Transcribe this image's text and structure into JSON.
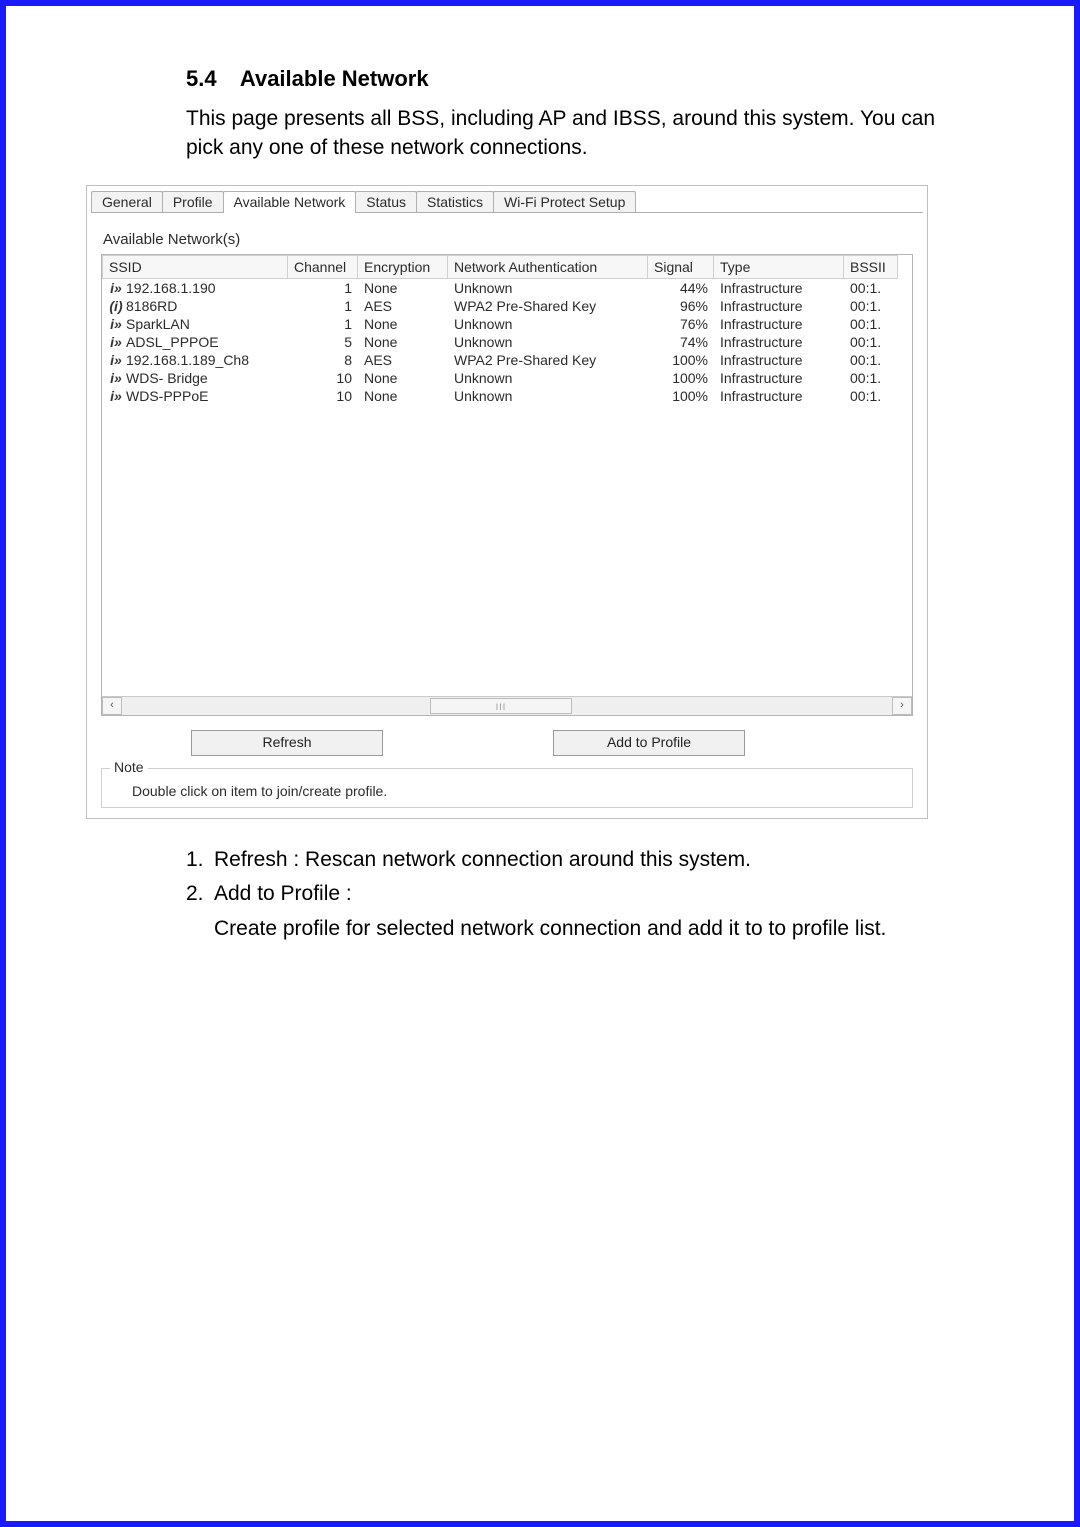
{
  "section": {
    "number": "5.4",
    "title": "Available Network",
    "intro": "This page presents all BSS, including AP and IBSS, around this system. You can pick any one of these network connections."
  },
  "tabs": {
    "general": "General",
    "profile": "Profile",
    "available_network": "Available Network",
    "status": "Status",
    "statistics": "Statistics",
    "wps": "Wi-Fi Protect Setup"
  },
  "group_label": "Available Network(s)",
  "columns": {
    "ssid": "SSID",
    "channel": "Channel",
    "encryption": "Encryption",
    "auth": "Network Authentication",
    "signal": "Signal",
    "type": "Type",
    "bssid": "BSSII"
  },
  "networks": [
    {
      "icon": "i»",
      "ssid": "192.168.1.190",
      "channel": "1",
      "encryption": "None",
      "auth": "Unknown",
      "signal": "44%",
      "type": "Infrastructure",
      "bssid": "00:1."
    },
    {
      "icon": "(i)",
      "ssid": "8186RD",
      "channel": "1",
      "encryption": "AES",
      "auth": "WPA2 Pre-Shared Key",
      "signal": "96%",
      "type": "Infrastructure",
      "bssid": "00:1."
    },
    {
      "icon": "i»",
      "ssid": "SparkLAN",
      "channel": "1",
      "encryption": "None",
      "auth": "Unknown",
      "signal": "76%",
      "type": "Infrastructure",
      "bssid": "00:1."
    },
    {
      "icon": "i»",
      "ssid": "ADSL_PPPOE",
      "channel": "5",
      "encryption": "None",
      "auth": "Unknown",
      "signal": "74%",
      "type": "Infrastructure",
      "bssid": "00:1."
    },
    {
      "icon": "i»",
      "ssid": "192.168.1.189_Ch8",
      "channel": "8",
      "encryption": "AES",
      "auth": "WPA2 Pre-Shared Key",
      "signal": "100%",
      "type": "Infrastructure",
      "bssid": "00:1."
    },
    {
      "icon": "i»",
      "ssid": "WDS- Bridge",
      "channel": "10",
      "encryption": "None",
      "auth": "Unknown",
      "signal": "100%",
      "type": "Infrastructure",
      "bssid": "00:1."
    },
    {
      "icon": "i»",
      "ssid": "WDS-PPPoE",
      "channel": "10",
      "encryption": "None",
      "auth": "Unknown",
      "signal": "100%",
      "type": "Infrastructure",
      "bssid": "00:1."
    }
  ],
  "buttons": {
    "refresh": "Refresh",
    "add_to_profile": "Add to Profile"
  },
  "note": {
    "legend": "Note",
    "text": "Double click on item to join/create profile."
  },
  "after_list": {
    "item1_label": "Refresh : Rescan network connection around this system.",
    "item2_label": "Add to Profile :",
    "item2_desc": "Create profile for selected network connection and add it to to profile list."
  }
}
